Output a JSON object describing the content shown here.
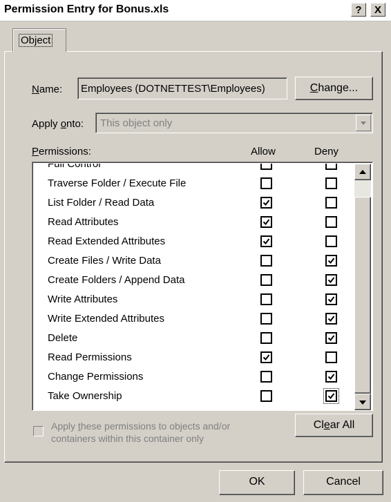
{
  "window": {
    "title": "Permission Entry for Bonus.xls",
    "help_button": "?",
    "close_button": "X"
  },
  "tabs": [
    {
      "label": "Object"
    }
  ],
  "name_field": {
    "label_prefix": "",
    "label_mnemonic": "N",
    "label_rest": "ame:",
    "value": "Employees (DOTNETTEST\\Employees)"
  },
  "change_button": {
    "mnemonic": "C",
    "rest": "hange..."
  },
  "apply_onto": {
    "label_prefix": "Apply ",
    "label_mnemonic": "o",
    "label_rest": "nto:",
    "value": "This object only"
  },
  "permissions": {
    "header_mnemonic": "P",
    "header_rest": "ermissions:",
    "allow_header": "Allow",
    "deny_header": "Deny",
    "partial_top_label": "Full Control",
    "rows": [
      {
        "label": "Traverse Folder / Execute File",
        "allow": false,
        "deny": false
      },
      {
        "label": "List Folder / Read Data",
        "allow": true,
        "deny": false
      },
      {
        "label": "Read Attributes",
        "allow": true,
        "deny": false
      },
      {
        "label": "Read Extended Attributes",
        "allow": true,
        "deny": false
      },
      {
        "label": "Create Files / Write Data",
        "allow": false,
        "deny": true
      },
      {
        "label": "Create Folders / Append Data",
        "allow": false,
        "deny": true
      },
      {
        "label": "Write Attributes",
        "allow": false,
        "deny": true
      },
      {
        "label": "Write Extended Attributes",
        "allow": false,
        "deny": true
      },
      {
        "label": "Delete",
        "allow": false,
        "deny": true
      },
      {
        "label": "Read Permissions",
        "allow": true,
        "deny": false
      },
      {
        "label": "Change Permissions",
        "allow": false,
        "deny": true
      },
      {
        "label": "Take Ownership",
        "allow": false,
        "deny": true
      }
    ]
  },
  "apply_children": {
    "line1_prefix": "Apply ",
    "line1_mnemonic": "t",
    "line1_rest": "hese permissions to objects and/or",
    "line2": "containers within this container only",
    "checked": false
  },
  "clear_all_button": {
    "prefix": "Cl",
    "mnemonic": "e",
    "rest": "ar All"
  },
  "ok_button": "OK",
  "cancel_button": "Cancel"
}
